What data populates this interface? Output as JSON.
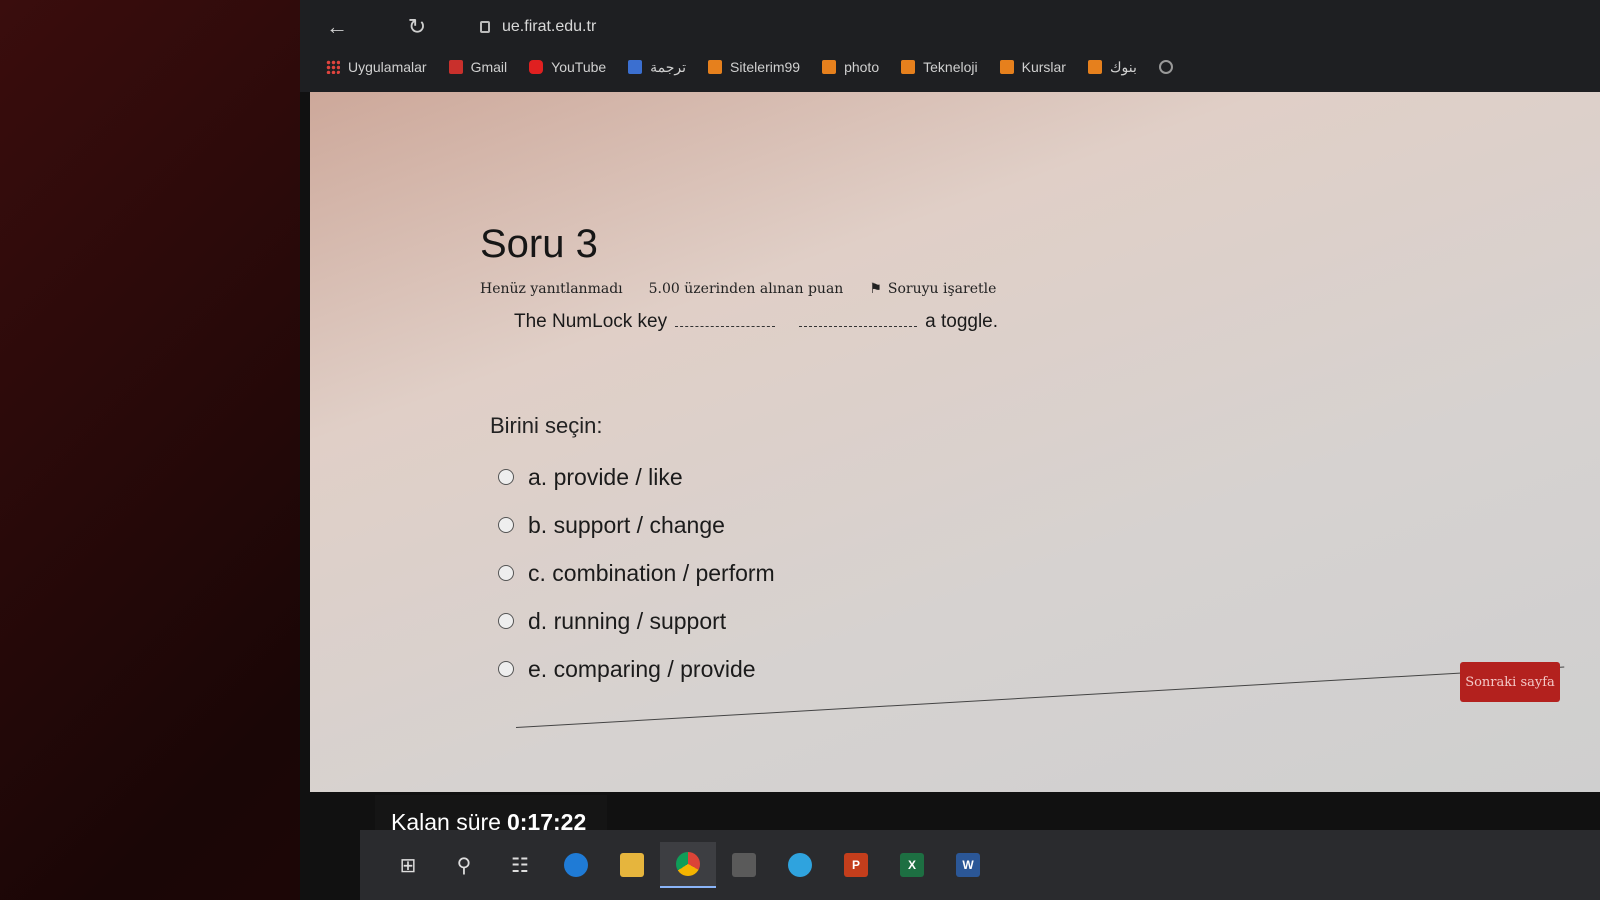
{
  "browser": {
    "url": "ue.firat.edu.tr",
    "bookmarks": [
      {
        "label": "Uygulamalar",
        "icon": "apps-icon"
      },
      {
        "label": "Gmail",
        "icon": "gmail-icon"
      },
      {
        "label": "YouTube",
        "icon": "youtube-icon"
      },
      {
        "label": "ترجمة",
        "icon": "translate-icon"
      },
      {
        "label": "Sitelerim99",
        "icon": "folder-icon"
      },
      {
        "label": "photo",
        "icon": "folder-icon"
      },
      {
        "label": "Tekneloji",
        "icon": "folder-icon"
      },
      {
        "label": "Kurslar",
        "icon": "folder-icon"
      },
      {
        "label": "بنوك",
        "icon": "folder-icon"
      }
    ]
  },
  "question": {
    "title": "Soru 3",
    "status": "Henüz yanıtlanmadı",
    "score": "5.00 üzerinden alınan puan",
    "flag_label": "Soruyu işaretle",
    "text_start": "The NumLock key",
    "text_end": "a toggle.",
    "prompt": "Birini seçin:",
    "options": [
      {
        "label": "a. provide / like"
      },
      {
        "label": "b. support / change"
      },
      {
        "label": "c. combination / perform"
      },
      {
        "label": "d. running / support"
      },
      {
        "label": "e. comparing / provide"
      }
    ],
    "next_label": "Sonraki sayfa"
  },
  "timer": {
    "label": "Kalan süre",
    "value": "0:17:22"
  },
  "colors": {
    "next_button": "#b3211e",
    "taskbar": "#2a2b2e"
  }
}
